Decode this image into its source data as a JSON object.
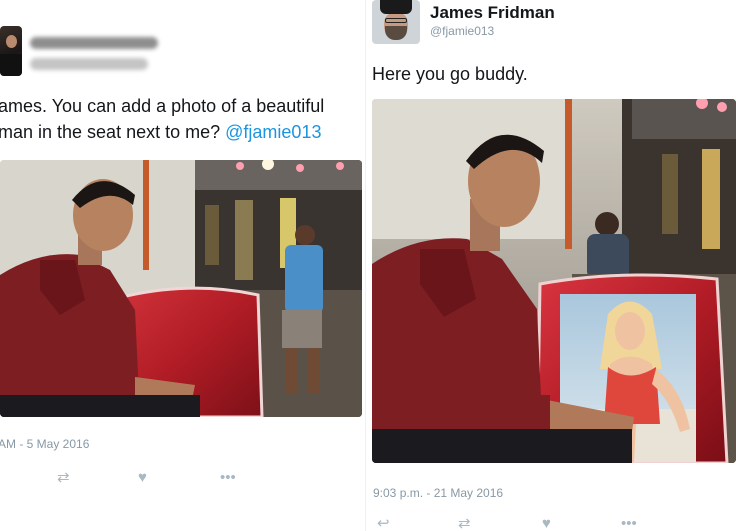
{
  "left_tweet": {
    "text_line1": "ames. You can add a photo of a beautiful",
    "text_line2_prefix": "man in the seat next to me? ",
    "mention": "@fjamie013",
    "timestamp": "AM - 5 May 2016",
    "icons": [
      "avatar",
      "photo",
      "retweet-icon",
      "like-icon",
      "more-icon"
    ]
  },
  "right_tweet": {
    "display_name": "James Fridman",
    "handle": "@fjamie013",
    "text": "Here you go buddy.",
    "timestamp": "9:03 p.m. - 21 May 2016",
    "icons": [
      "avatar",
      "photo",
      "reply-icon",
      "retweet-icon",
      "like-icon",
      "more-icon"
    ]
  },
  "colors": {
    "link": "#1b95e0",
    "muted": "#8899a6",
    "action_icon": "#aab8c2",
    "shirt": "#7d1e22"
  }
}
